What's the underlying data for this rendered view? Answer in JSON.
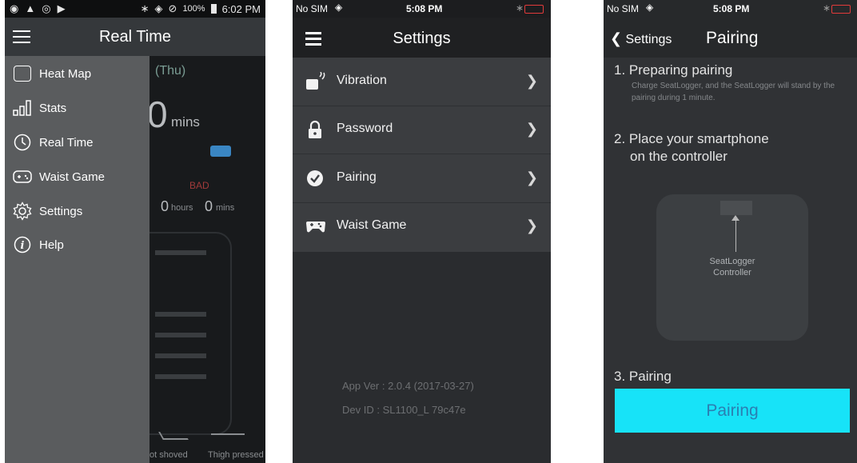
{
  "screen1": {
    "status": {
      "battery": "100%",
      "time": "6:02 PM"
    },
    "title": "Real Time",
    "background": {
      "day": "(Thu)",
      "big_number": "0",
      "unit_mins": "mins",
      "bad_label": "BAD",
      "hours_value": "0",
      "hours_unit": "hours",
      "mins_value": "0",
      "mins_unit": "mins",
      "foot_label_1": "ot shoved",
      "foot_label_2": "Thigh pressed"
    },
    "drawer": [
      {
        "label": "Heat Map",
        "icon": "heat-map-icon"
      },
      {
        "label": "Stats",
        "icon": "stats-icon"
      },
      {
        "label": "Real Time",
        "icon": "clock-icon"
      },
      {
        "label": "Waist Game",
        "icon": "gamepad-icon"
      },
      {
        "label": "Settings",
        "icon": "gear-icon"
      },
      {
        "label": "Help",
        "icon": "info-icon"
      }
    ]
  },
  "screen2": {
    "status": {
      "carrier": "No SIM",
      "time": "5:08 PM"
    },
    "title": "Settings",
    "items": [
      {
        "label": "Vibration",
        "icon": "vibration-icon"
      },
      {
        "label": "Password",
        "icon": "lock-icon"
      },
      {
        "label": "Pairing",
        "icon": "check-circle-icon"
      },
      {
        "label": "Waist Game",
        "icon": "gamepad-icon"
      }
    ],
    "app_version": "App Ver : 2.0.4 (2017-03-27)",
    "dev_id": "Dev ID : SL1100_L 79c47e"
  },
  "screen3": {
    "status": {
      "carrier": "No SIM",
      "time": "5:08 PM"
    },
    "back_label": "Settings",
    "title": "Pairing",
    "step1_title": "1. Preparing pairing",
    "step1_desc": "Charge SeatLogger, and the SeatLogger will stand by the pairing during 1 minute.",
    "step2_line1": "2. Place your smartphone",
    "step2_line2": "on the controller",
    "controller_line1": "SeatLogger",
    "controller_line2": "Controller",
    "step3_title": "3. Pairing",
    "pair_button": "Pairing",
    "colors": {
      "accent": "#17e3f8",
      "button_text": "#2a7fb2"
    }
  }
}
